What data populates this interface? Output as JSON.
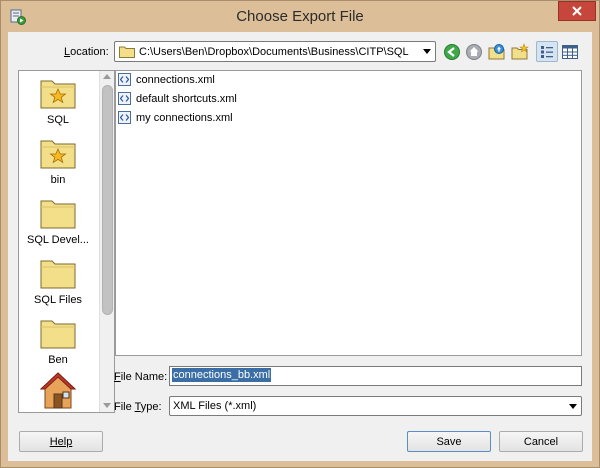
{
  "window": {
    "title": "Choose Export File",
    "app_icon": "export-app-icon",
    "close_icon": "close-icon"
  },
  "location": {
    "label_prefix": "L",
    "label_rest": "ocation:",
    "path": "C:\\Users\\Ben\\Dropbox\\Documents\\Business\\CITP\\SQL"
  },
  "toolbar": {
    "icons": [
      "back-icon",
      "home-icon",
      "up-folder-icon",
      "new-folder-icon",
      "list-view-icon",
      "details-view-icon"
    ],
    "active_view": "list-view"
  },
  "places": {
    "items": [
      {
        "label": "SQL",
        "icon": "starred-folder-icon"
      },
      {
        "label": "bin",
        "icon": "starred-folder-icon"
      },
      {
        "label": "SQL Devel...",
        "icon": "folder-icon"
      },
      {
        "label": "SQL Files",
        "icon": "folder-icon"
      },
      {
        "label": "Ben",
        "icon": "folder-icon"
      },
      {
        "label": "",
        "icon": "home-icon"
      }
    ]
  },
  "files": {
    "items": [
      {
        "name": "connections.xml"
      },
      {
        "name": "default shortcuts.xml"
      },
      {
        "name": "my connections.xml"
      }
    ]
  },
  "file_name": {
    "label_prefix": "F",
    "label_rest": "ile Name:",
    "value": "connections_bb.xml"
  },
  "file_type": {
    "label_prefix": "File ",
    "label_mnemonic": "T",
    "label_rest": "ype:",
    "value": "XML Files (*.xml)"
  },
  "buttons": {
    "help": "Help",
    "save": "Save",
    "cancel": "Cancel"
  },
  "colors": {
    "title_bar": "#dcbe99",
    "close_button": "#c7463c",
    "selection": "#3a6ea5",
    "folder": "#f3df8a"
  }
}
